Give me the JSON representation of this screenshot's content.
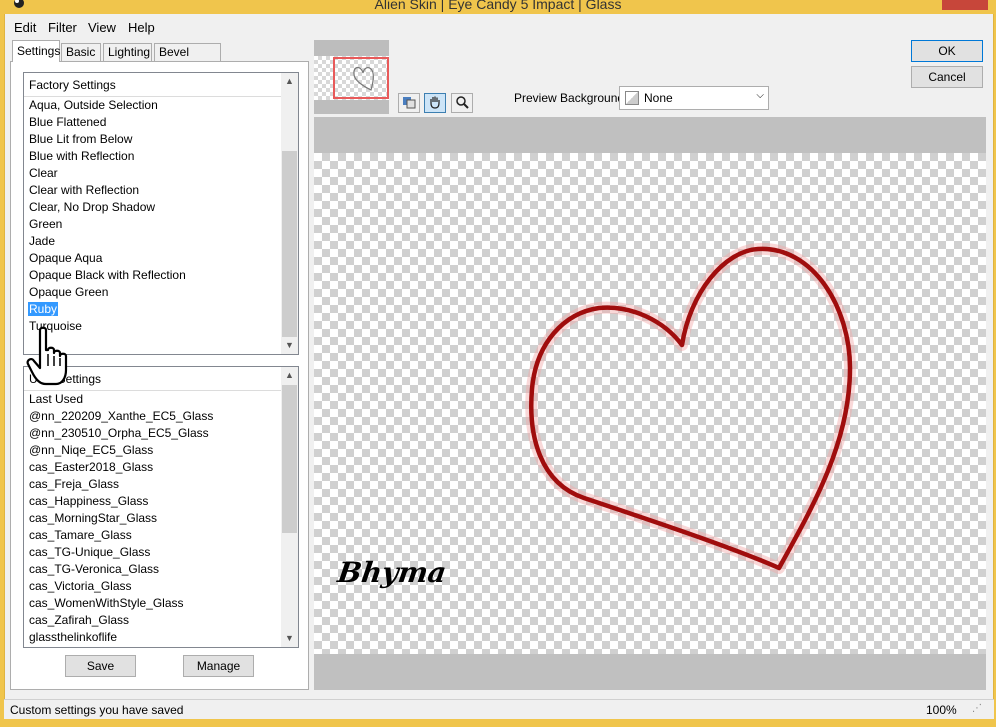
{
  "window": {
    "title": "Alien Skin | Eye Candy 5 Impact | Glass"
  },
  "menu": [
    "Edit",
    "Filter",
    "View",
    "Help"
  ],
  "tabs": [
    "Settings",
    "Basic",
    "Lighting",
    "Bevel Profile"
  ],
  "factory_settings": {
    "header": "Factory Settings",
    "items": [
      "Aqua, Outside Selection",
      "Blue Flattened",
      "Blue Lit from Below",
      "Blue with Reflection",
      "Clear",
      "Clear with Reflection",
      "Clear, No Drop Shadow",
      "Green",
      "Jade",
      "Opaque Aqua",
      "Opaque Black with Reflection",
      "Opaque Green",
      "Ruby",
      "Turquoise"
    ],
    "selected": "Ruby"
  },
  "user_settings": {
    "header": "User Settings",
    "items": [
      "Last Used",
      "@nn_220209_Xanthe_EC5_Glass",
      "@nn_230510_Orpha_EC5_Glass",
      "@nn_Niqe_EC5_Glass",
      "cas_Easter2018_Glass",
      "cas_Freja_Glass",
      "cas_Happiness_Glass",
      "cas_MorningStar_Glass",
      "cas_Tamare_Glass",
      "cas_TG-Unique_Glass",
      "cas_TG-Veronica_Glass",
      "cas_Victoria_Glass",
      "cas_WomenWithStyle_Glass",
      "cas_Zafirah_Glass",
      "glassthelinkoflife"
    ]
  },
  "buttons": {
    "save": "Save",
    "manage": "Manage",
    "ok": "OK",
    "cancel": "Cancel"
  },
  "preview": {
    "background_label": "Preview Background:",
    "background_value": "None",
    "watermark": "Bhyma",
    "stroke_color": "#a00d0d"
  },
  "status": {
    "text": "Custom settings you have saved",
    "zoom": "100%"
  },
  "icons": {
    "tool_1": "compare-icon",
    "tool_2": "hand-icon",
    "tool_3": "zoom-icon"
  },
  "colors": {
    "title_bar": "#f0c54c",
    "selection": "#3399ff",
    "close_button": "#c7463a"
  }
}
